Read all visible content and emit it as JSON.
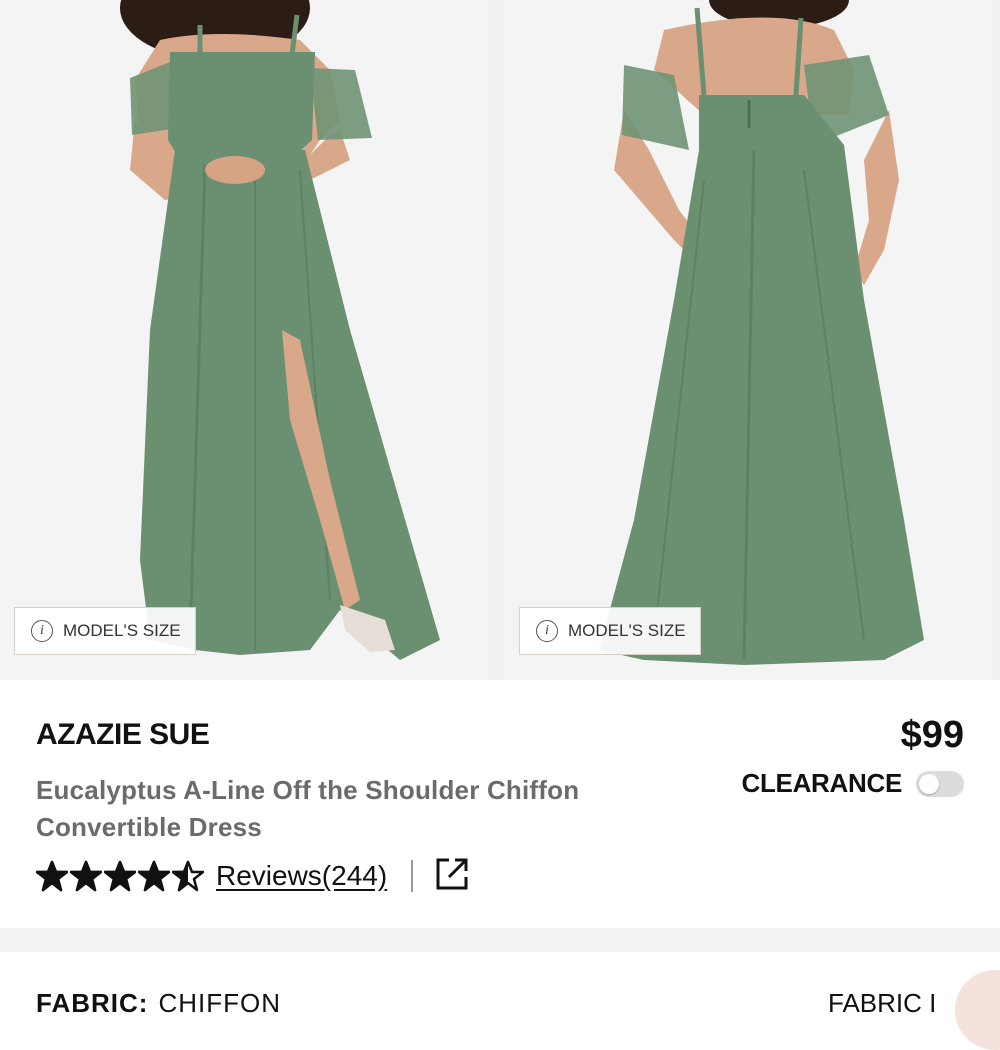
{
  "gallery": {
    "images": [
      {
        "alt": "front view",
        "model_size_label": "MODEL'S SIZE"
      },
      {
        "alt": "back view",
        "model_size_label": "MODEL'S SIZE"
      }
    ],
    "dress_color": "#6b8f71",
    "skin_color": "#d9a88a",
    "hair_color": "#2b1d16"
  },
  "product": {
    "brand": "AZAZIE SUE",
    "price": "$99",
    "clearance_label": "CLEARANCE",
    "clearance_on": false,
    "title": "Eucalyptus A-Line Off the Shoulder Chiffon Convertible Dress",
    "rating": 4.5,
    "reviews_label": "Reviews(244)"
  },
  "details": {
    "fabric_label": "FABRIC:",
    "fabric_value": "CHIFFON",
    "right_label": "FABRIC I"
  },
  "icons": {
    "info": "info-icon",
    "share": "external-link-icon",
    "star": "star-icon"
  }
}
